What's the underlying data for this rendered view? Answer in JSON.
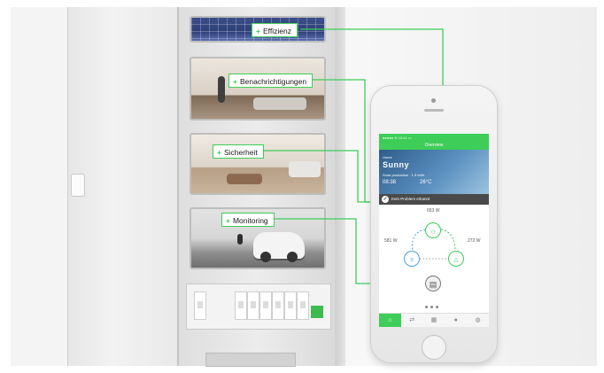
{
  "labels": {
    "effizienz": "Effizienz",
    "benachrichtigungen": "Benachrichtigungen",
    "sicherheit": "Sicherheit",
    "monitoring": "Monitoring",
    "plus": "+"
  },
  "app": {
    "header_title": "Overview",
    "status": "●●●●● ≋   10:41   ▭",
    "weather": {
      "city": "Home",
      "headline": "Sunny",
      "detail": "Solar production · 1.9 kWh",
      "time": "08:38",
      "temp": "26°C"
    },
    "alert_icon": "✓",
    "alert_text": "Kein Problem erkannt",
    "power": {
      "solar": "653 W",
      "grid": "581 W",
      "home": "272 W"
    },
    "tabs": [
      "⌂",
      "⇄",
      "▦",
      "●",
      "◍"
    ],
    "active_tab": 0
  },
  "colors": {
    "accent": "#3dcd58",
    "grid_blue": "#4aa3df",
    "alert_bg": "#4a4a4a"
  }
}
